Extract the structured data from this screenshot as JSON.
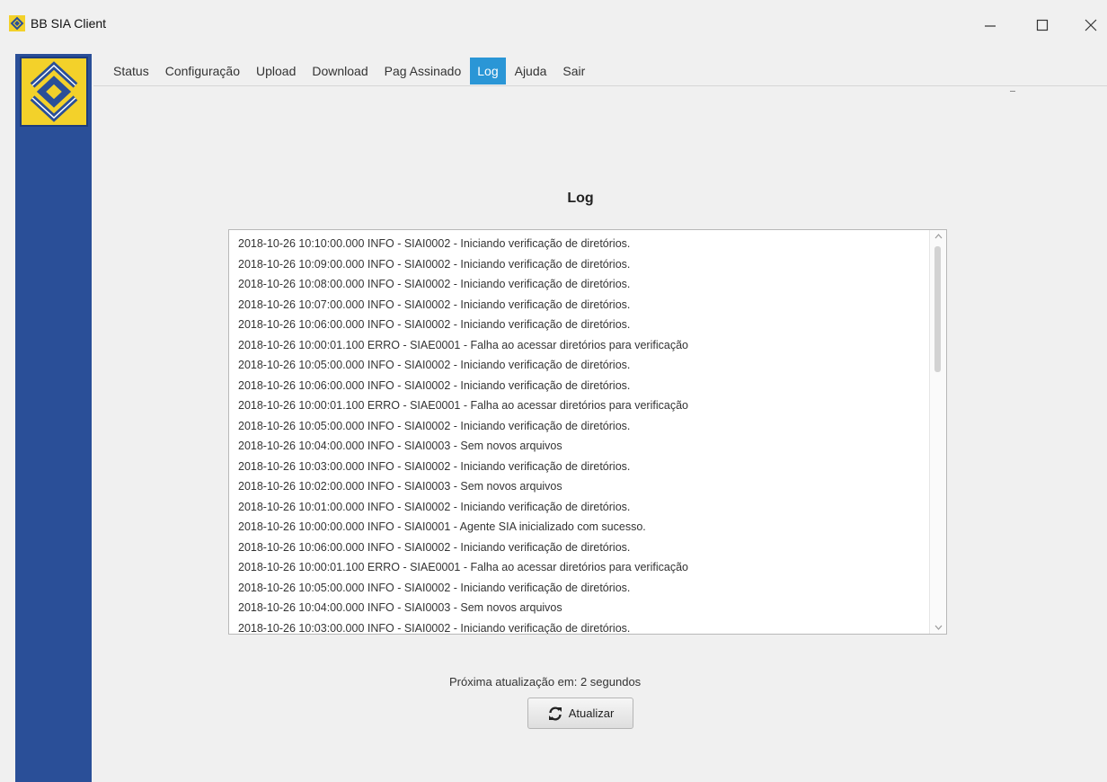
{
  "window": {
    "title": "BB SIA Client",
    "controls": {
      "minimize": "—",
      "maximize": "☐",
      "close": "✕"
    }
  },
  "menu": {
    "items": [
      {
        "label": "Status",
        "active": false
      },
      {
        "label": "Configuração",
        "active": false
      },
      {
        "label": "Upload",
        "active": false
      },
      {
        "label": "Download",
        "active": false
      },
      {
        "label": "Pag Assinado",
        "active": false
      },
      {
        "label": "Log",
        "active": true
      },
      {
        "label": "Ajuda",
        "active": false
      },
      {
        "label": "Sair",
        "active": false
      }
    ]
  },
  "page": {
    "heading": "Log"
  },
  "log": {
    "lines": [
      "2018-10-26 10:10:00.000 INFO - SIAI0002 - Iniciando verificação de diretórios.",
      "2018-10-26 10:09:00.000 INFO - SIAI0002 - Iniciando verificação de diretórios.",
      "2018-10-26 10:08:00.000 INFO - SIAI0002 - Iniciando verificação de diretórios.",
      "2018-10-26 10:07:00.000 INFO - SIAI0002 - Iniciando verificação de diretórios.",
      "2018-10-26 10:06:00.000 INFO - SIAI0002 - Iniciando verificação de diretórios.",
      "2018-10-26 10:00:01.100 ERRO - SIAE0001 - Falha ao acessar diretórios para verificação",
      "2018-10-26 10:05:00.000 INFO - SIAI0002 - Iniciando verificação de diretórios.",
      "2018-10-26 10:06:00.000 INFO - SIAI0002 - Iniciando verificação de diretórios.",
      "2018-10-26 10:00:01.100 ERRO - SIAE0001 - Falha ao acessar diretórios para verificação",
      "2018-10-26 10:05:00.000 INFO - SIAI0002 - Iniciando verificação de diretórios.",
      "2018-10-26 10:04:00.000 INFO - SIAI0003 - Sem novos arquivos",
      "2018-10-26 10:03:00.000 INFO - SIAI0002 - Iniciando verificação de diretórios.",
      "2018-10-26 10:02:00.000 INFO - SIAI0003 - Sem novos arquivos",
      "2018-10-26 10:01:00.000 INFO - SIAI0002 - Iniciando verificação de diretórios.",
      "2018-10-26 10:00:00.000 INFO - SIAI0001 - Agente SIA inicializado com sucesso.",
      "2018-10-26 10:06:00.000 INFO - SIAI0002 - Iniciando verificação de diretórios.",
      "2018-10-26 10:00:01.100 ERRO - SIAE0001 - Falha ao acessar diretórios para verificação",
      "2018-10-26 10:05:00.000 INFO - SIAI0002 - Iniciando verificação de diretórios.",
      "2018-10-26 10:04:00.000 INFO - SIAI0003 - Sem novos arquivos",
      "2018-10-26 10:03:00.000 INFO - SIAI0002 - Iniciando verificação de diretórios."
    ]
  },
  "footer": {
    "next_update": "Próxima atualização em: 2  segundos",
    "refresh_label": "Atualizar"
  },
  "colors": {
    "sidebar": "#2a4f98",
    "logo_bg": "#f3d12a",
    "active_tab": "#2a96d6"
  }
}
